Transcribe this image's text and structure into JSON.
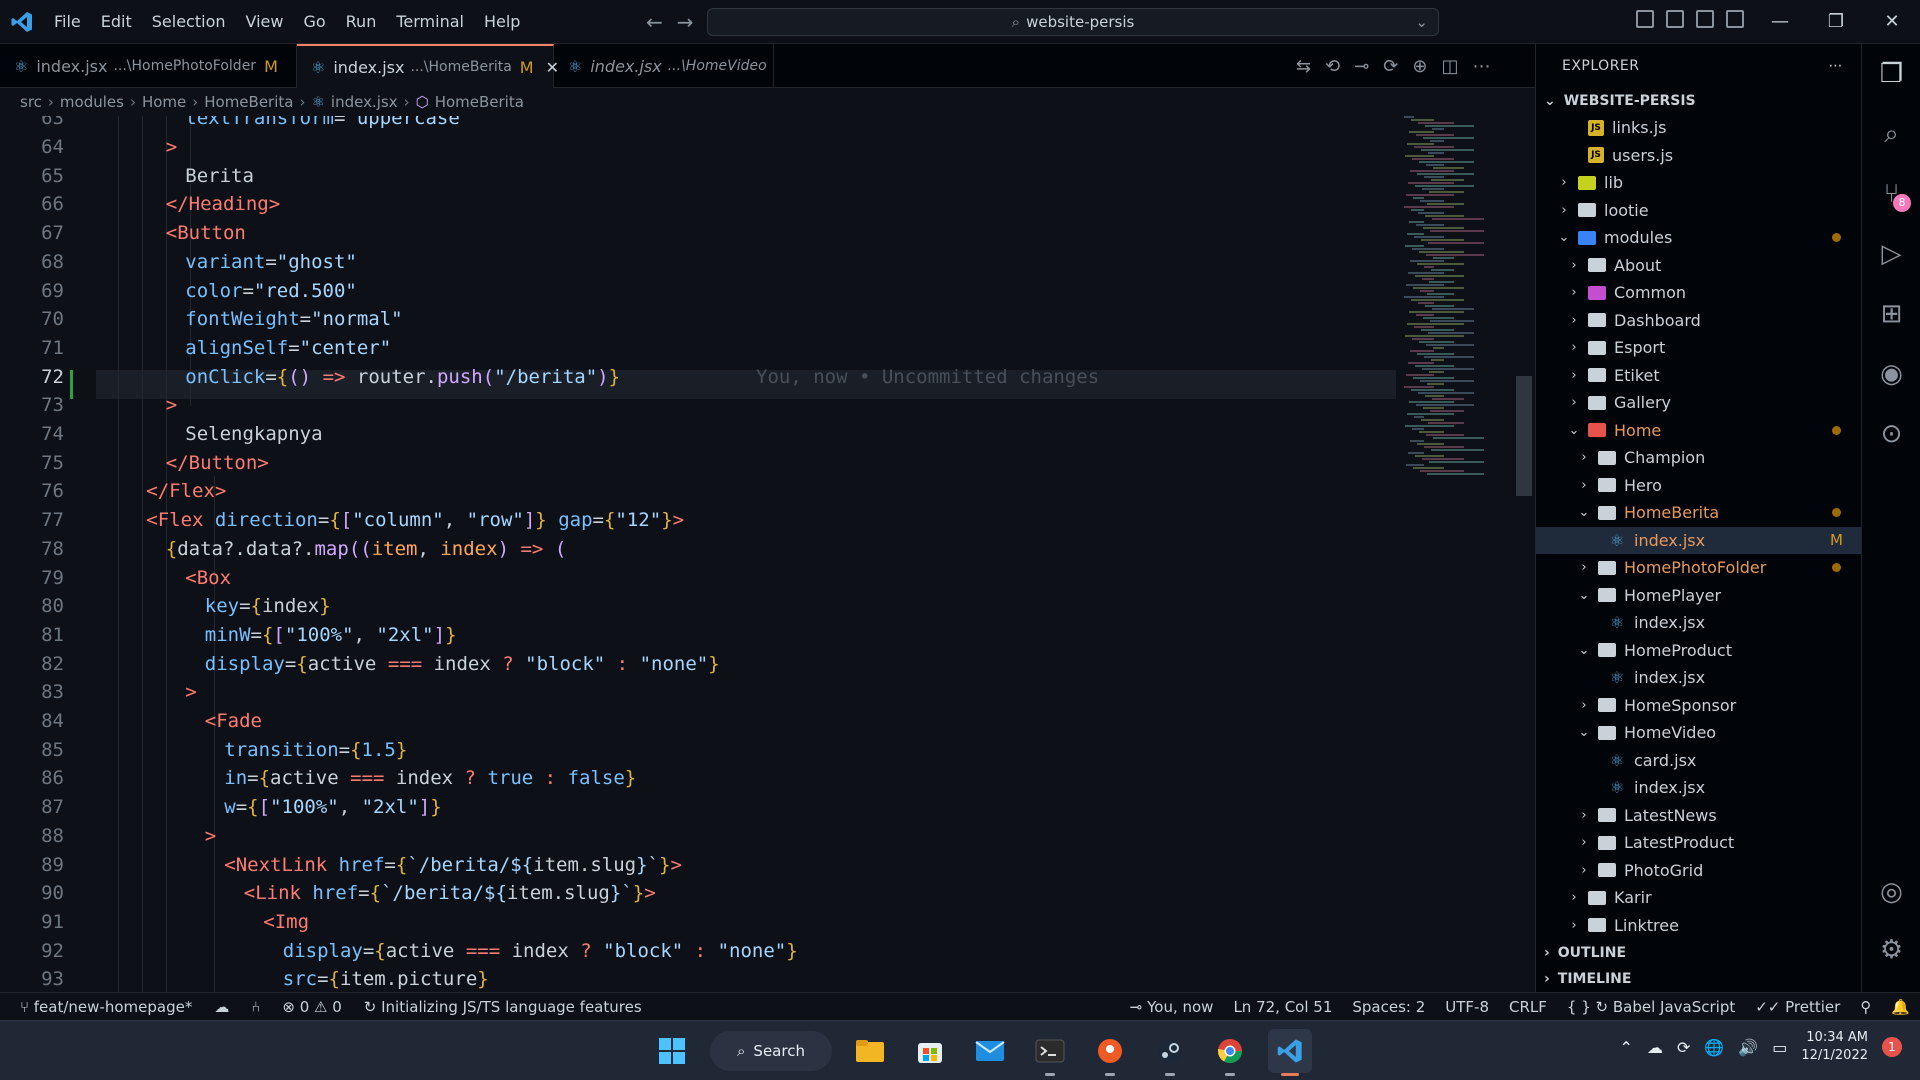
{
  "menu": [
    "File",
    "Edit",
    "Selection",
    "View",
    "Go",
    "Run",
    "Terminal",
    "Help"
  ],
  "search": {
    "text": "website-persis"
  },
  "tabs": [
    {
      "name": "index.jsx",
      "desc": "...\\HomePhotoFolder",
      "mod": "M"
    },
    {
      "name": "index.jsx",
      "desc": "...\\HomeBerita",
      "mod": "M"
    },
    {
      "name": "index.jsx",
      "desc": "...\\HomeVideo"
    }
  ],
  "breadcrumb": [
    "src",
    "modules",
    "Home",
    "HomeBerita",
    "index.jsx",
    "HomeBerita"
  ],
  "editor": {
    "line_numbers": [
      "63",
      "64",
      "65",
      "66",
      "67",
      "68",
      "69",
      "70",
      "71",
      "72",
      "73",
      "74",
      "75",
      "76",
      "77",
      "78",
      "79",
      "80",
      "81",
      "82",
      "83",
      "84",
      "85",
      "86",
      "87",
      "88",
      "89",
      "90",
      "91",
      "92",
      "93"
    ],
    "blame": "You, now • Uncommitted changes"
  },
  "explorer": {
    "title": "EXPLORER",
    "root": "WEBSITE-PERSIS",
    "items": [
      {
        "label": "links.js"
      },
      {
        "label": "users.js"
      },
      {
        "label": "lib"
      },
      {
        "label": "lootie"
      },
      {
        "label": "modules"
      },
      {
        "label": "About"
      },
      {
        "label": "Common"
      },
      {
        "label": "Dashboard"
      },
      {
        "label": "Esport"
      },
      {
        "label": "Etiket"
      },
      {
        "label": "Gallery"
      },
      {
        "label": "Home"
      },
      {
        "label": "Champion"
      },
      {
        "label": "Hero"
      },
      {
        "label": "HomeBerita"
      },
      {
        "label": "index.jsx"
      },
      {
        "label": "HomePhotoFolder"
      },
      {
        "label": "HomePlayer"
      },
      {
        "label": "index.jsx"
      },
      {
        "label": "HomeProduct"
      },
      {
        "label": "index.jsx"
      },
      {
        "label": "HomeSponsor"
      },
      {
        "label": "HomeVideo"
      },
      {
        "label": "card.jsx"
      },
      {
        "label": "index.jsx"
      },
      {
        "label": "LatestNews"
      },
      {
        "label": "LatestProduct"
      },
      {
        "label": "PhotoGrid"
      },
      {
        "label": "Karir"
      },
      {
        "label": "Linktree"
      }
    ],
    "mod_badge": "M",
    "outline": "OUTLINE",
    "timeline": "TIMELINE"
  },
  "activity_badge": "8",
  "status": {
    "branch": "feat/new-homepage*",
    "errors": "0",
    "warnings": "0",
    "init": "Initializing JS/TS language features",
    "blame": "You, now",
    "position": "Ln 72, Col 51",
    "spaces": "Spaces: 2",
    "encoding": "UTF-8",
    "eol": "CRLF",
    "braces": "{ }",
    "language": "Babel JavaScript",
    "prettier": "Prettier"
  },
  "taskbar": {
    "search": "Search",
    "time": "10:34 AM",
    "date": "12/1/2022",
    "notifications": "1"
  },
  "colors": {
    "accent": "#f78166",
    "modified": "#d29922",
    "react": "#4fa6d8"
  }
}
